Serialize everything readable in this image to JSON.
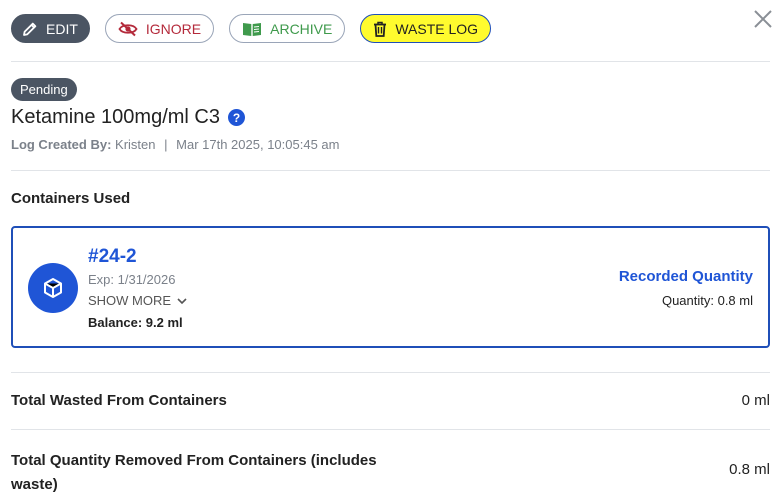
{
  "toolbar": {
    "edit_label": "EDIT",
    "ignore_label": "IGNORE",
    "archive_label": "ARCHIVE",
    "waste_label": "WASTE LOG"
  },
  "icons": {
    "edit": "pencil-icon",
    "ignore": "eye-off-icon",
    "archive": "book-icon",
    "waste": "trash-icon",
    "close": "close-icon",
    "help": "help-icon",
    "container": "cube-icon",
    "show_more": "chevron-down-icon"
  },
  "colors": {
    "accent": "#1f55d6",
    "ignore": "#b42a3b",
    "archive": "#3f9a4c",
    "highlight": "#fffb2e",
    "badge": "#4b5563"
  },
  "log": {
    "status": "Pending",
    "title": "Ketamine 100mg/ml C3",
    "help_glyph": "?",
    "created_by_label": "Log Created By:",
    "created_by": "Kristen",
    "separator": "|",
    "created_at": "Mar 17th 2025, 10:05:45 am"
  },
  "containers": {
    "heading": "Containers Used",
    "items": [
      {
        "name": "#24-2",
        "exp": "Exp: 1/31/2026",
        "show_more": "SHOW MORE",
        "balance": "Balance: 9.2 ml",
        "recorded_label": "Recorded Quantity",
        "quantity": "Quantity: 0.8 ml"
      }
    ]
  },
  "totals": {
    "wasted_label": "Total Wasted From Containers",
    "wasted_value": "0 ml",
    "removed_label_line1": "Total Quantity Removed From Containers (includes",
    "removed_label_line2": "waste)",
    "removed_value": "0.8 ml"
  }
}
